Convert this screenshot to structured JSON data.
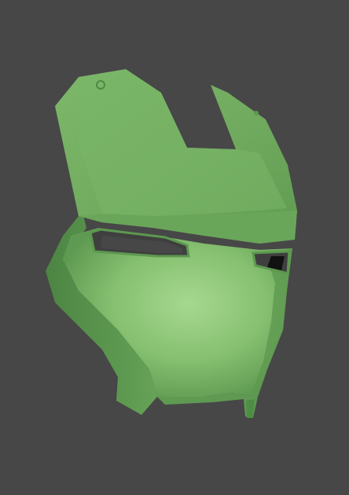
{
  "scene": {
    "subject": "mask-3d-model",
    "colors": {
      "background": "#474747",
      "shell_light": "#9fd289",
      "shell_mid": "#78b466",
      "shell_dark": "#4f8c45",
      "shell_shadow": "#3c6e36",
      "eye_hole": "#474747",
      "eye_inner": "#111111"
    }
  }
}
